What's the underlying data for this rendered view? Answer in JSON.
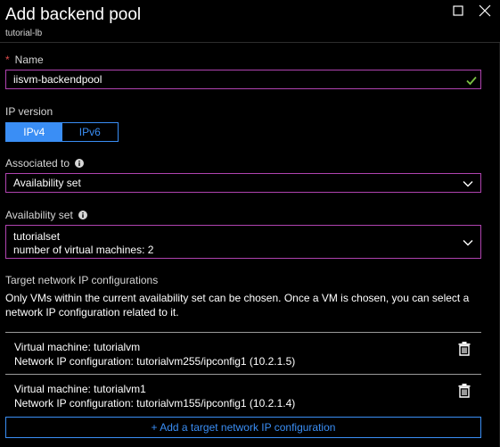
{
  "header": {
    "title": "Add backend pool",
    "subtitle": "tutorial-lb"
  },
  "name_field": {
    "label": "Name",
    "required_mark": "*",
    "value": "iisvm-backendpool"
  },
  "ip_version": {
    "label": "IP version",
    "options": [
      "IPv4",
      "IPv6"
    ],
    "selected": "IPv4"
  },
  "associated_to": {
    "label": "Associated to",
    "value": "Availability set"
  },
  "availability_set": {
    "label": "Availability set",
    "name": "tutorialset",
    "detail": "number of virtual machines: 2"
  },
  "target_configs": {
    "title": "Target network IP configurations",
    "description": "Only VMs within the current availability set can be chosen. Once a VM is chosen, you can select a network IP configuration related to it.",
    "rows": [
      {
        "vm": "Virtual machine: tutorialvm",
        "ip": "Network IP configuration: tutorialvm255/ipconfig1 (10.2.1.5)"
      },
      {
        "vm": "Virtual machine: tutorialvm1",
        "ip": "Network IP configuration: tutorialvm155/ipconfig1 (10.2.1.4)"
      }
    ],
    "add_label": "+ Add a target network IP configuration"
  },
  "colors": {
    "accent_blue": "#3a8ef5",
    "focus_border": "#b043b0",
    "valid_check": "#7bc142",
    "required_star": "#e04c4c"
  },
  "icons": {
    "maximize": "maximize-icon",
    "close": "close-icon",
    "info": "info-icon",
    "check": "checkmark-icon",
    "chevron": "chevron-down-icon",
    "delete": "trash-icon"
  }
}
